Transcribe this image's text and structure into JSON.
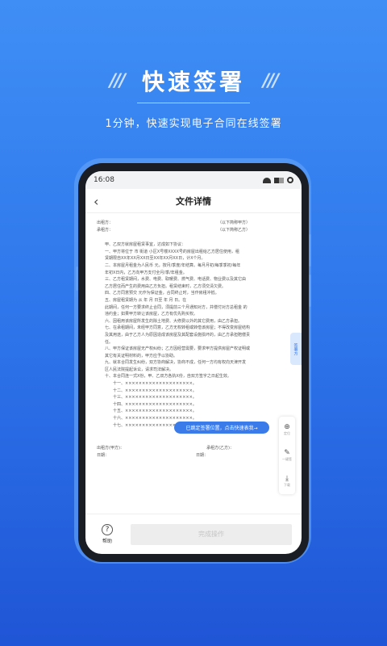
{
  "hero": {
    "title": "快速签署",
    "subtitle": "1分钟，快速实现电子合同在线签署",
    "deco_left": "///",
    "deco_right": "///"
  },
  "status_bar": {
    "time": "16:08"
  },
  "nav": {
    "title": "文件详情",
    "back_icon": "chevron-left-icon"
  },
  "document": {
    "party_a_label": "出租方：",
    "party_a_value": "（以下简称甲方）",
    "party_b_label": "承租方：",
    "party_b_value": "（以下简称乙方）",
    "paragraphs": [
      "甲、乙双方就房屋租赁事宜，达成如下协议：",
      "一、甲方将位于    市    街道    小区X号楼XXXX号的房屋出租给乙方居住使用，租",
      "赁期限自XX年XX月XX日至XX年XX月XX日，计X个月。",
      "二、本房屋月租金为人民币    元，按月/季度/年结算。每月月初/每季季初/每年",
      "年初X日内，乙方向甲方支付全月/季/年租金。",
      "三、乙方租赁期间，水费、电费、取暖费、燃气费、电话费、物业费以及其它由",
      "乙方居住而产生的费用由乙方负担。租赁结束时，乙方须交清欠费。",
      "四、乙方同意预交    元作为保证金，合同终止时，当作房租冲抵。",
      "五、房屋租赁期为    从    年    月    日至    年    月    日。在",
      "此期间，任何一方要求终止合同，须提前三个月通知对方，并偿付对方总租金    的",
      "违约金；如果甲方转让该房屋，乙方有优先购买权。",
      "六、因租用该房屋所发生的除土地费、大修费以外的其它费用，由乙方承担。",
      "七、在承租期间，未经甲方同意，乙方无权转租或转借该房屋；不得改变房屋结构",
      "及其用途，由于乙方人为原因造成该房屋及其配套设施损坏的，由乙方承担赔偿责",
      "任。",
      "八、甲方保证该房屋无产权纠纷；乙方因经营需要，要求甲方提供房屋产权证明或",
      "其它有关证明材料的，甲方应予以协助。",
      "九、就本合同发生纠纷，双方协商解决，协商不成，任何一方均有权向天津开发",
      "区人民法院提起诉讼，请求司法解决。",
      "十、本合同连一式X份，甲、乙双方各执X份，自双方签字之日起生效。"
    ],
    "numbered": [
      "十一、××××××××××××××××××××。",
      "十二、××××××××××××××××××××。",
      "十三、××××××××××××××××××××。",
      "十四、××××××××××××××××××××。",
      "十五、××××××××××××××××××××。",
      "十六、××××××××××××××××××××。",
      "十七、××××××××××××××××××××。"
    ],
    "sign_a": "出租方(甲方)：",
    "sign_b": "承租方(乙方)：",
    "date_label": "日期：",
    "date_label_2": "日期："
  },
  "float_tab": "签署方",
  "toast": "已跳定签署位置，点击快速表我→",
  "tools": [
    {
      "icon": "locate-icon",
      "label": "定位"
    },
    {
      "icon": "pen-icon",
      "label": "一键签"
    },
    {
      "icon": "download-icon",
      "label": "下载"
    }
  ],
  "bottom": {
    "help_label": "帮助",
    "help_icon": "question-icon",
    "complete_label": "完成操作"
  }
}
